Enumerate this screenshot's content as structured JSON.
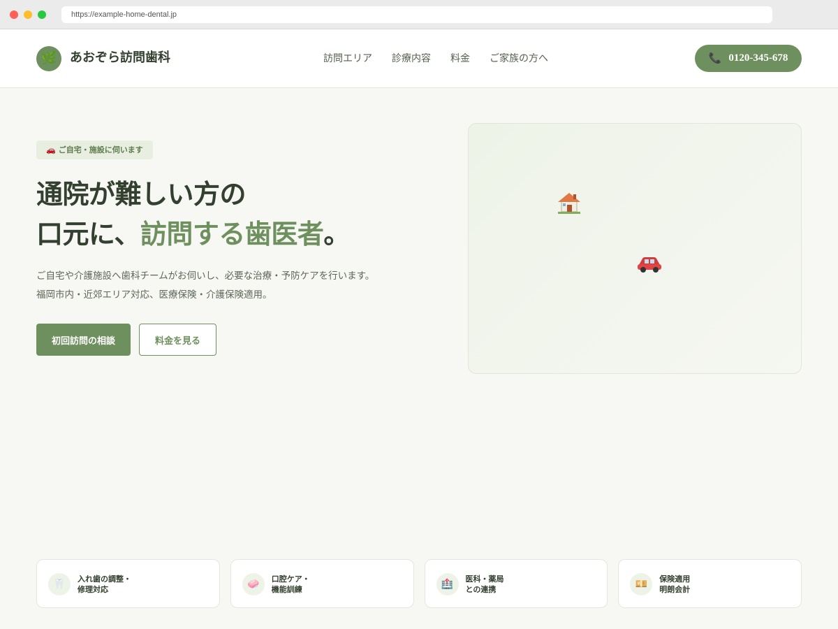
{
  "browser": {
    "url": "https://example-home-dental.jp"
  },
  "header": {
    "logo_icon": "leaf-icon",
    "site_name": "あおぞら訪問歯科",
    "nav": [
      "訪問エリア",
      "診療内容",
      "料金",
      "ご家族の方へ"
    ],
    "phone": "0120-345-678",
    "phone_icon": "phone-icon"
  },
  "hero": {
    "badge": "ご自宅・施設に伺います",
    "badge_icon": "car-icon",
    "title_line1": "通院が難しい方の",
    "title_line2_prefix": "口元に、",
    "title_line2_accent": "訪問する歯医者",
    "title_line2_suffix": "。",
    "lead_line1": "ご自宅や介護施設へ歯科チームがお伺いし、必要な治療・予防ケアを行います。",
    "lead_line2": "福岡市内・近郊エリア対応、医療保険・介護保険適用。",
    "primary_cta": "初回訪問の相談",
    "secondary_cta": "料金を見る",
    "visual_icons": [
      "house-icon",
      "car-icon"
    ]
  },
  "features": [
    {
      "icon": "tooth-icon",
      "text": "入れ歯の調整・\n修理対応"
    },
    {
      "icon": "soap-icon",
      "text": "口腔ケア・\n機能訓練"
    },
    {
      "icon": "hospital-icon",
      "text": "医科・薬局\nとの連携"
    },
    {
      "icon": "money-icon",
      "text": "保険適用\n明朗会計"
    }
  ],
  "colors": {
    "accent": "#6e8f5e",
    "text": "#33402f",
    "background": "#f7f8f3"
  }
}
